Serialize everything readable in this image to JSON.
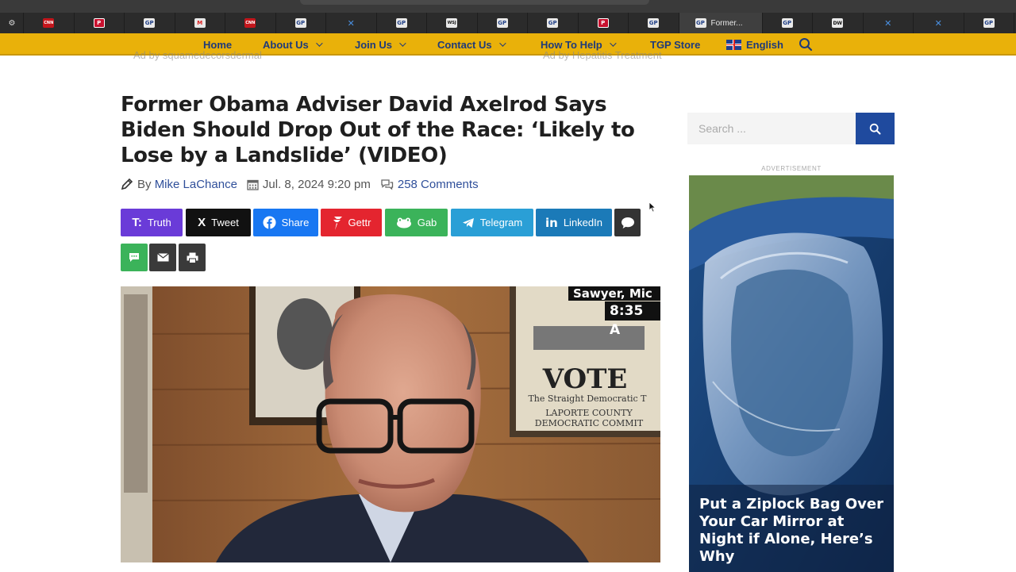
{
  "browser": {
    "tabs": [
      {
        "icon": "settings-icon",
        "glyph": "⚙"
      },
      {
        "icon": "cnn-icon",
        "glyph": "CNN"
      },
      {
        "icon": "p-icon",
        "glyph": "P"
      },
      {
        "icon": "gp-icon",
        "glyph": "GP"
      },
      {
        "icon": "m-icon",
        "glyph": "M"
      },
      {
        "icon": "cnn-icon",
        "glyph": "CNN"
      },
      {
        "icon": "gp-icon",
        "glyph": "GP"
      },
      {
        "icon": "x-icon",
        "glyph": "✕"
      },
      {
        "icon": "gp-icon",
        "glyph": "GP"
      },
      {
        "icon": "wsj-icon",
        "glyph": "WSJ"
      },
      {
        "icon": "gp-icon",
        "glyph": "GP"
      },
      {
        "icon": "gp-icon",
        "glyph": "GP"
      },
      {
        "icon": "p-icon",
        "glyph": "P"
      },
      {
        "icon": "gp-icon",
        "glyph": "GP"
      },
      {
        "icon": "gp-icon",
        "glyph": "GP",
        "title": "Former..."
      },
      {
        "icon": "gp-icon",
        "glyph": "GP"
      },
      {
        "icon": "dw-icon",
        "glyph": "DW"
      },
      {
        "icon": "x-icon",
        "glyph": "✕"
      },
      {
        "icon": "x-icon",
        "glyph": "✕"
      },
      {
        "icon": "gp-icon",
        "glyph": "GP"
      }
    ]
  },
  "nav": {
    "home": "Home",
    "about": "About Us",
    "join": "Join Us",
    "contact": "Contact Us",
    "help": "How To Help",
    "store": "TGP Store",
    "language": "English"
  },
  "ads_top": {
    "left": "Ad by squamedecorsdermal",
    "right": "Ad by Hepatitis Treatment"
  },
  "article": {
    "title": "Former Obama Adviser David Axelrod Says Biden Should Drop Out of the Race: ‘Likely to Lose by a Landslide’ (VIDEO)",
    "by": "By",
    "author": "Mike LaChance",
    "date": "Jul. 8, 2024 9:20 pm",
    "comments": "258 Comments",
    "share": {
      "truth": "Truth",
      "tweet": "Tweet",
      "share": "Share",
      "gettr": "Gettr",
      "gab": "Gab",
      "telegram": "Telegram",
      "linkedin": "LinkedIn"
    },
    "video": {
      "location": "Sawyer, Mic",
      "time": "8:35 A",
      "poster_line1": "VOTE",
      "poster_line2": "The Straight Democratic T",
      "poster_line3": "LAPORTE COUNTY",
      "poster_line4": "DEMOCRATIC COMMIT"
    }
  },
  "sidebar": {
    "search_placeholder": "Search ...",
    "ad_label": "ADVERTISEMENT",
    "ad_headline": "Put a Ziplock Bag Over Your Car Mirror at Night if Alone, Here’s Why"
  },
  "colors": {
    "nav_bg": "#e9b10a",
    "nav_text": "#1e3a7a",
    "link": "#2f4f9a",
    "truth": "#6a3bd8",
    "tweet": "#111111",
    "share": "#1877f2",
    "gettr": "#e4252f",
    "gab": "#3bb35a",
    "telegram": "#2a9fd6",
    "linkedin": "#1b7ab8",
    "search_btn": "#1f4a9e"
  }
}
